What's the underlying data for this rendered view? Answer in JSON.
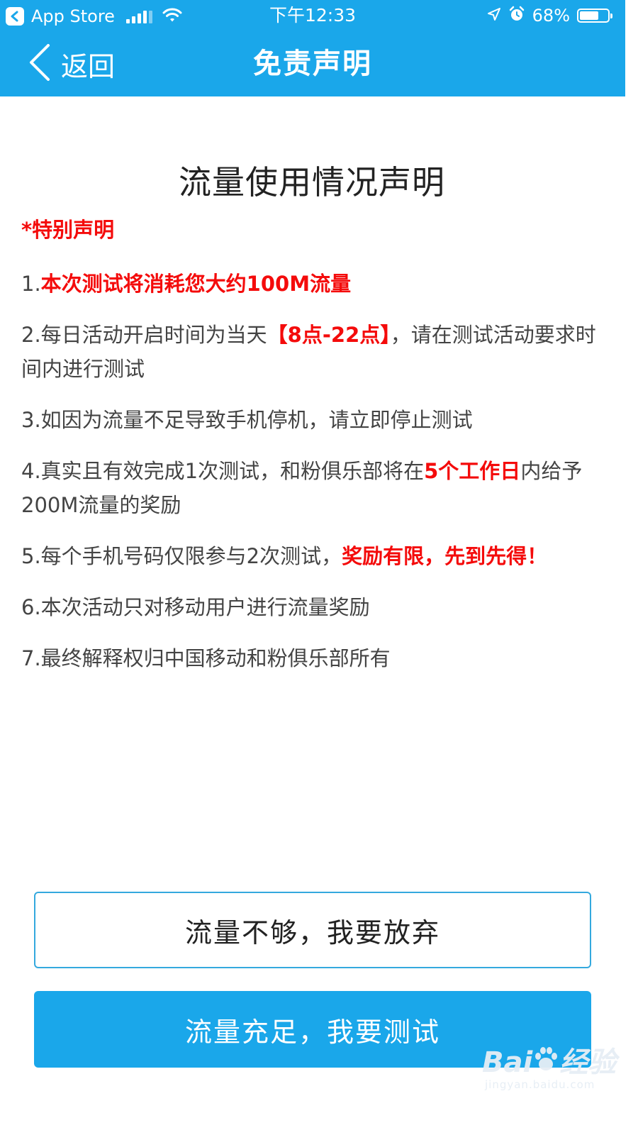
{
  "status_bar": {
    "back_app": "App Store",
    "time": "下午12:33",
    "battery": "68%",
    "battery_level": 0.68
  },
  "nav": {
    "back_label": "返回",
    "title": "免责声明"
  },
  "document": {
    "title": "流量使用情况声明",
    "special_note": "*特别声明",
    "items": [
      {
        "prefix": "1.",
        "text": "本次测试将消耗您大约100M流量"
      },
      {
        "prefix": "2.每日活动开启时间为当天",
        "highlight": "【8点-22点】",
        "suffix": "，请在测试活动要求时间内进行测试"
      },
      {
        "text": "3.如因为流量不足导致手机停机，请立即停止测试"
      },
      {
        "prefix": "4.真实且有效完成1次测试，和粉俱乐部将在",
        "highlight": "5个工作日",
        "suffix": "内给予200M流量的奖励"
      },
      {
        "prefix": "5.每个手机号码仅限参与2次测试，",
        "highlight": "奖励有限，先到先得！"
      },
      {
        "text": "6.本次活动只对移动用户进行流量奖励"
      },
      {
        "text": "7.最终解释权归中国移动和粉俱乐部所有"
      }
    ]
  },
  "buttons": {
    "give_up": "流量不够，我要放弃",
    "test": "流量充足，我要测试"
  },
  "watermark": {
    "brand_left": "Bai",
    "brand_right": "经验",
    "url": "jingyan.baidu.com"
  },
  "colors": {
    "header_blue": "#1aa7ea",
    "highlight_red": "#f40b0b"
  }
}
